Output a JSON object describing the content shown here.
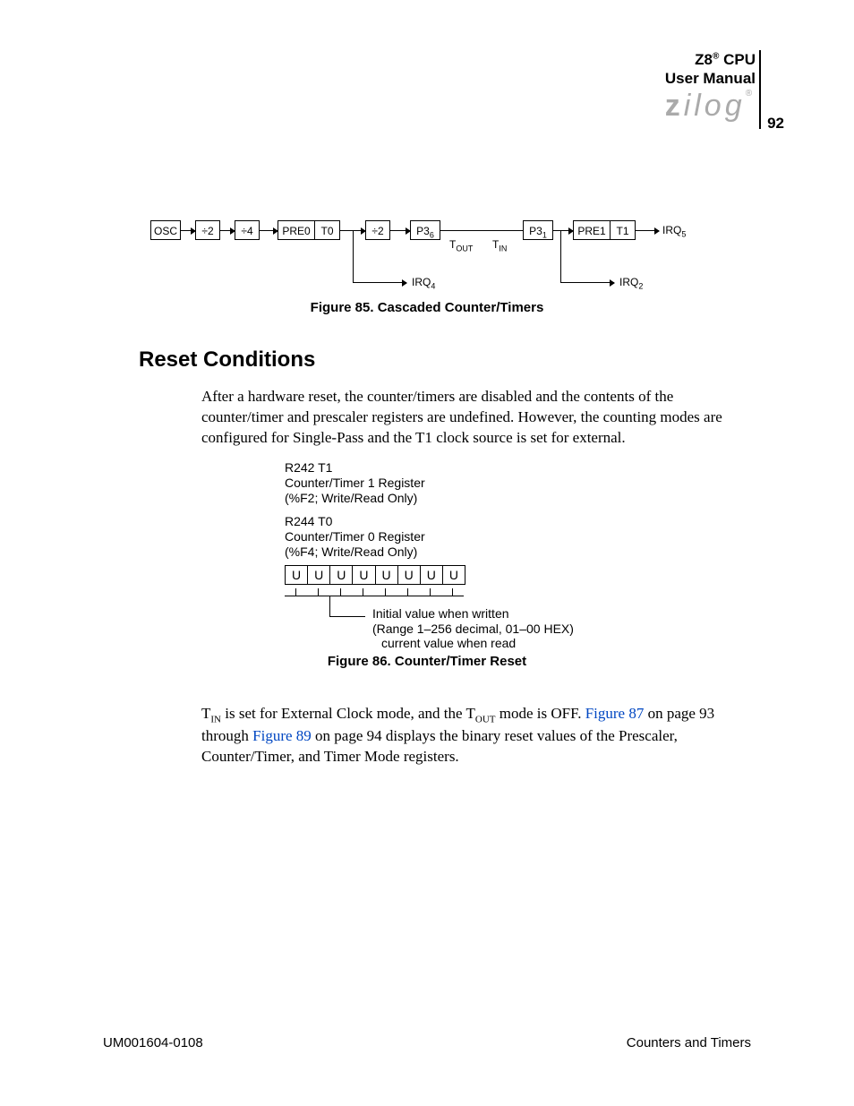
{
  "header": {
    "product_prefix": "Z8",
    "reg": "®",
    "product_suffix": "CPU",
    "subtitle": "User Manual",
    "brand": "zilog",
    "page_number": "92"
  },
  "fig85": {
    "blocks": [
      "OSC",
      "÷2",
      "÷4",
      "PRE0",
      "T0",
      "÷2",
      "P3₆",
      "P3₁",
      "PRE1",
      "T1"
    ],
    "labels": {
      "tout": "T_OUT",
      "tin": "T_IN",
      "irq5": "IRQ₅",
      "irq4": "IRQ₄",
      "irq2": "IRQ₂"
    },
    "caption": "Figure 85. Cascaded Counter/Timers"
  },
  "section": {
    "heading": "Reset Conditions",
    "para1": "After a hardware reset, the counter/timers are disabled and the contents of the counter/timer and prescaler registers are undefined. However, the counting modes are configured for Single-Pass and the T1 clock source is set for external.",
    "para2_a": " is set for External Clock mode, and the T",
    "para2_b": " mode is OFF. ",
    "link1": "Figure 87",
    "para2_c": " on page 93 through ",
    "link2": "Figure 89",
    "para2_d": " on page 94 displays the binary reset values of the Prescaler, Counter/Timer, and Timer Mode registers."
  },
  "fig86": {
    "reg1": {
      "name": "R242 T1",
      "desc": "Counter/Timer 1 Register",
      "addr": "(%F2; Write/Read Only)"
    },
    "reg2": {
      "name": "R244 T0",
      "desc": "Counter/Timer 0 Register",
      "addr": "(%F4; Write/Read Only)"
    },
    "bits": [
      "U",
      "U",
      "U",
      "U",
      "U",
      "U",
      "U",
      "U"
    ],
    "desc": [
      "Initial value when written",
      "(Range 1–256 decimal, 01–00 HEX)",
      "current value when read"
    ],
    "caption": "Figure 86. Counter/Timer Reset"
  },
  "footer": {
    "doc_id": "UM001604-0108",
    "chapter": "Counters and Timers"
  }
}
